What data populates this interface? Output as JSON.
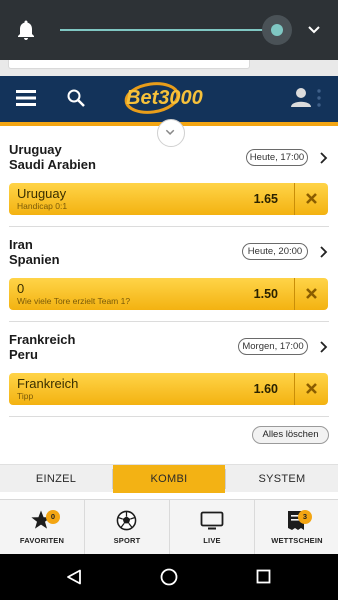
{
  "header": {
    "logo_text": "Bet3000"
  },
  "bets": [
    {
      "team_home": "Uruguay",
      "team_away": "Saudi Arabien",
      "time": "Heute, 17:00",
      "selection": "Uruguay",
      "market": "Handicap 0:1",
      "odds": "1.65"
    },
    {
      "team_home": "Iran",
      "team_away": "Spanien",
      "time": "Heute, 20:00",
      "selection": "0",
      "market": "Wie viele Tore erzielt Team 1?",
      "odds": "1.50"
    },
    {
      "team_home": "Frankreich",
      "team_away": "Peru",
      "time": "Morgen, 17:00",
      "selection": "Frankreich",
      "market": "Tipp",
      "odds": "1.60"
    }
  ],
  "clear_all_label": "Alles löschen",
  "tabs": [
    {
      "label": "EINZEL",
      "active": false
    },
    {
      "label": "KOMBI",
      "active": true
    },
    {
      "label": "SYSTEM",
      "active": false
    }
  ],
  "bottom_nav": [
    {
      "label": "FAVORITEN",
      "icon": "star-icon",
      "badge": "0"
    },
    {
      "label": "SPORT",
      "icon": "soccer-ball-icon"
    },
    {
      "label": "LIVE",
      "icon": "tv-icon"
    },
    {
      "label": "WETTSCHEIN",
      "icon": "betslip-icon",
      "badge": "3"
    }
  ],
  "brightness_level": 0.85,
  "colors": {
    "header_bg": "#13335a",
    "accent": "#f3a512",
    "pick_bg": "#ffcc33",
    "shade_bg": "#2d3236",
    "slider": "#7fc7c3"
  }
}
